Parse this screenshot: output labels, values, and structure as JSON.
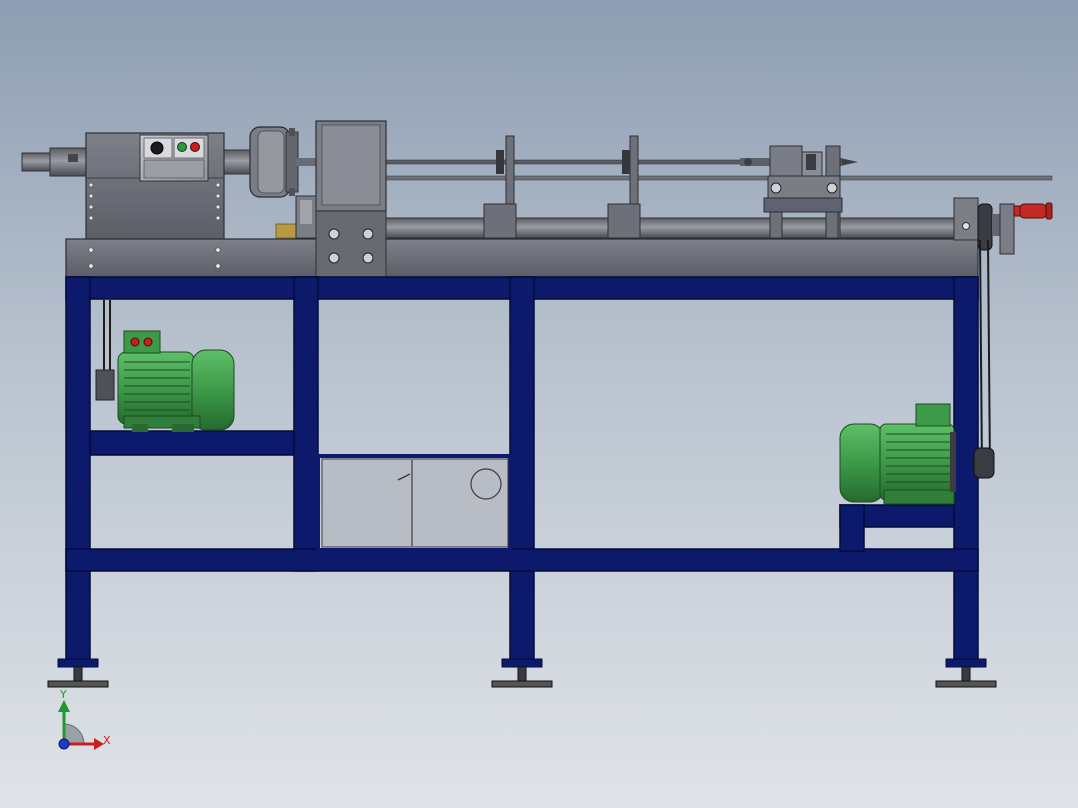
{
  "viewport": {
    "background_top": "#8e9db2",
    "background_bottom": "#dfe3e7"
  },
  "colors": {
    "frame": "#0d1a6b",
    "frame_edge": "#050b3a",
    "machine_gray": "#6d7079",
    "machine_light": "#a3a6ad",
    "motor_green": "#3d9a48",
    "motor_green_dark": "#256a2e",
    "button_red": "#c8201c",
    "button_green": "#2c9a3a",
    "handle_red": "#c42a24",
    "brass": "#b89a40"
  },
  "triad": {
    "x_label": "X",
    "y_label": "Y",
    "x_color": "#c8201c",
    "y_color": "#1e9a2e",
    "z_color": "#1e3ac8"
  }
}
